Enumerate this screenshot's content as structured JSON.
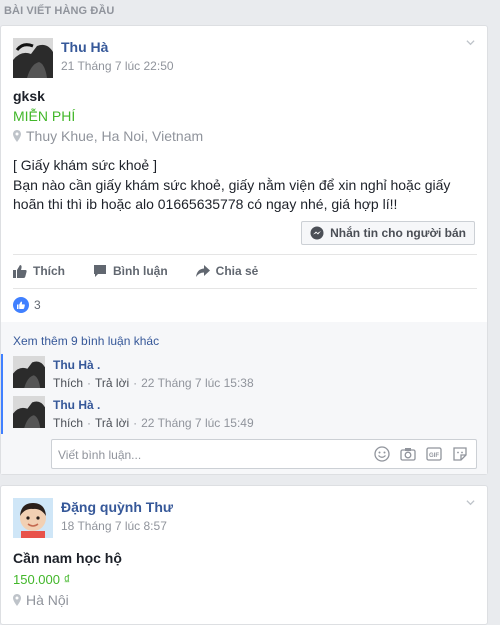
{
  "section_header": "BÀI VIẾT HÀNG ĐẦU",
  "post1": {
    "author": "Thu Hà",
    "timestamp": "21 Tháng 7 lúc 22:50",
    "title": "gksk",
    "price": "MIỄN PHÍ",
    "location": "Thuy Khue, Ha Noi, Vietnam",
    "body_line1": "[ Giấy khám sức khoẻ ]",
    "body_line2": "Bạn nào cần giấy khám sức khoẻ, giấy nằm viện để xin nghỉ hoặc giấy hoãn thi thì ib hoặc alo 01665635778 có ngay nhé, giá hợp lí!!",
    "message_button": "Nhắn tin cho người bán",
    "actions": {
      "like": "Thích",
      "comment": "Bình luận",
      "share": "Chia sẻ"
    },
    "reaction_count": "3",
    "view_more": "Xem thêm 9 bình luận khác",
    "comments": [
      {
        "name": "Thu Hà .",
        "like": "Thích",
        "reply": "Trả lời",
        "time": "22 Tháng 7 lúc 15:38"
      },
      {
        "name": "Thu Hà .",
        "like": "Thích",
        "reply": "Trả lời",
        "time": "22 Tháng 7 lúc 15:49"
      }
    ],
    "comment_placeholder": "Viết bình luận..."
  },
  "post2": {
    "author": "Đặng quỳnh Thư",
    "timestamp": "18 Tháng 7 lúc 8:57",
    "title": "Cần nam học hộ",
    "price": "150.000 ₫",
    "location": "Hà Nội"
  },
  "colors": {
    "link": "#365899",
    "price": "#42b72a",
    "meta": "#90949c",
    "accent": "#4080ff"
  }
}
